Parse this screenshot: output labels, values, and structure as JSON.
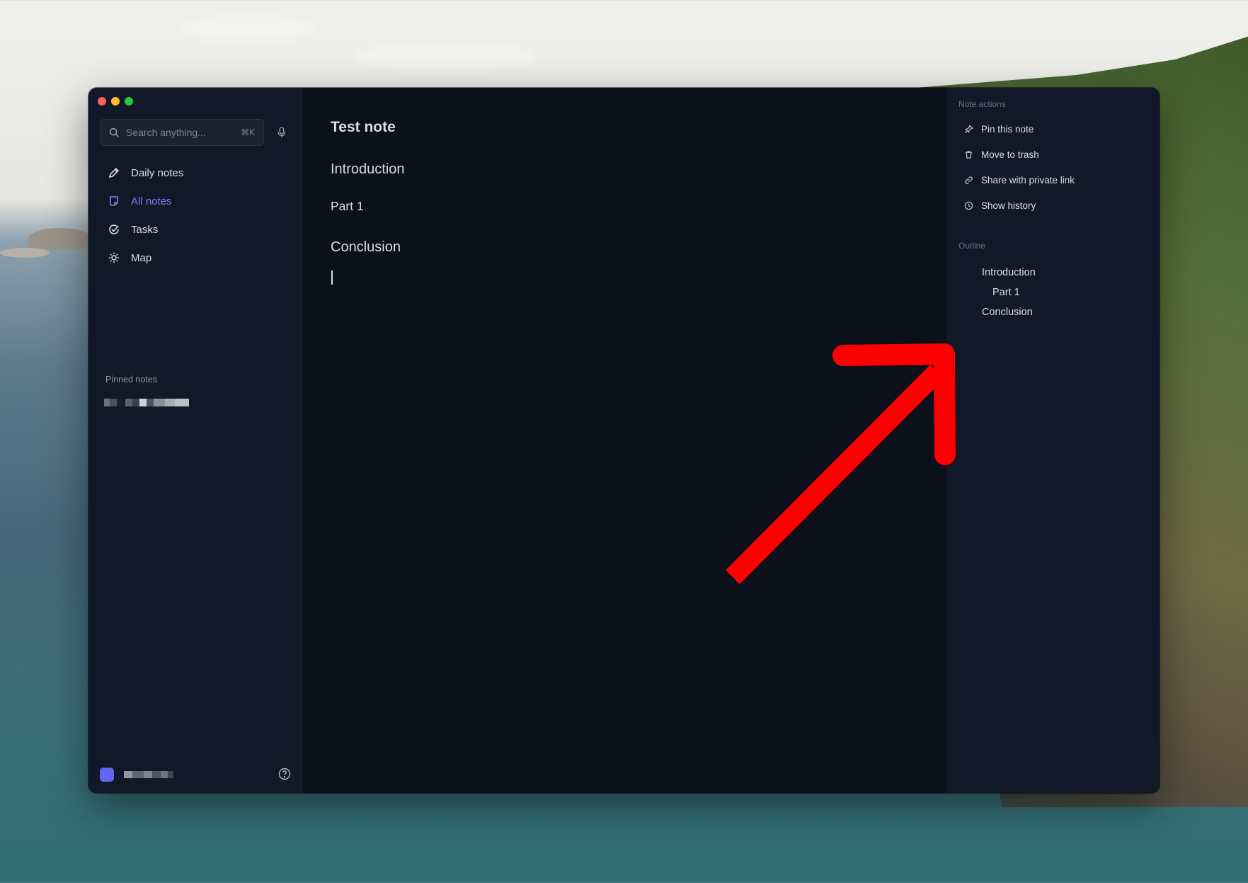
{
  "search": {
    "placeholder": "Search anything...",
    "shortcut": "⌘K"
  },
  "nav": {
    "items": [
      {
        "label": "Daily notes",
        "icon": "pencil-icon"
      },
      {
        "label": "All notes",
        "icon": "note-icon",
        "active": true
      },
      {
        "label": "Tasks",
        "icon": "check-circle-icon"
      },
      {
        "label": "Map",
        "icon": "sun-icon"
      }
    ]
  },
  "sidebar": {
    "pinned_label": "Pinned notes"
  },
  "editor": {
    "title": "Test note",
    "headings": [
      "Introduction",
      "Part 1",
      "Conclusion"
    ]
  },
  "note_actions": {
    "label": "Note actions",
    "items": [
      {
        "label": "Pin this note",
        "icon": "pin-icon"
      },
      {
        "label": "Move to trash",
        "icon": "trash-icon"
      },
      {
        "label": "Share with private link",
        "icon": "link-icon"
      },
      {
        "label": "Show history",
        "icon": "clock-icon"
      }
    ]
  },
  "outline": {
    "label": "Outline",
    "items": [
      "Introduction",
      "Part 1",
      "Conclusion"
    ]
  },
  "colors": {
    "accent": "#6366f1",
    "annotation_arrow": "#ff0000"
  }
}
